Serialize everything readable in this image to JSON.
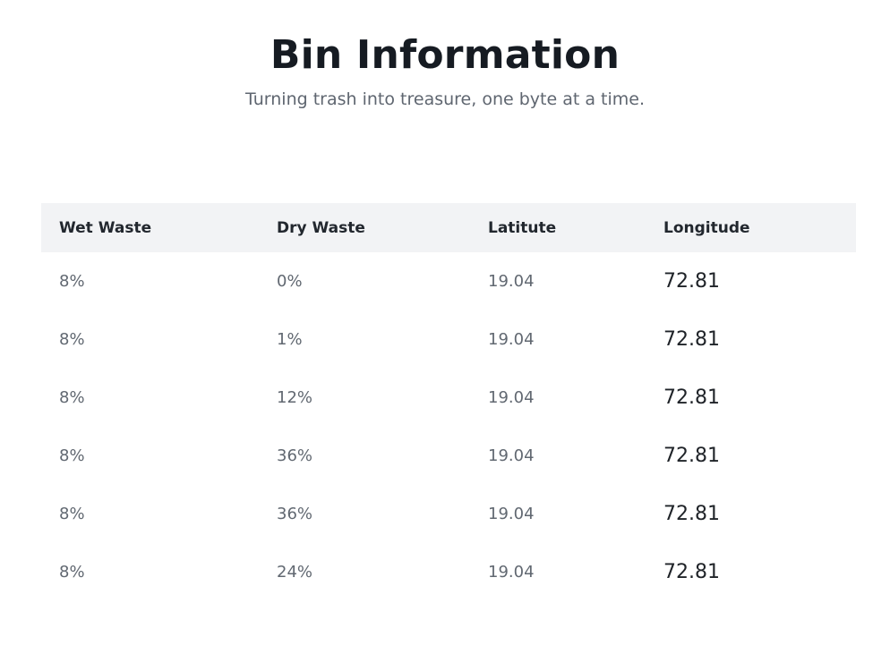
{
  "header": {
    "title": "Bin Information",
    "subtitle": "Turning trash into treasure, one byte at a time."
  },
  "table": {
    "columns": [
      "Wet Waste",
      "Dry Waste",
      "Latitute",
      "Longitude"
    ],
    "rows": [
      [
        "8%",
        "0%",
        "19.04",
        "72.81"
      ],
      [
        "8%",
        "1%",
        "19.04",
        "72.81"
      ],
      [
        "8%",
        "12%",
        "19.04",
        "72.81"
      ],
      [
        "8%",
        "36%",
        "19.04",
        "72.81"
      ],
      [
        "8%",
        "36%",
        "19.04",
        "72.81"
      ],
      [
        "8%",
        "24%",
        "19.04",
        "72.81"
      ]
    ]
  }
}
